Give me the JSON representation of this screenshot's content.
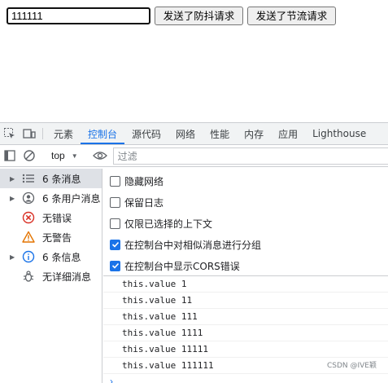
{
  "page": {
    "input_value": "111111",
    "debounce_button": "发送了防抖请求",
    "throttle_button": "发送了节流请求"
  },
  "devtools": {
    "tabs": [
      {
        "label": "元素",
        "active": false
      },
      {
        "label": "控制台",
        "active": true
      },
      {
        "label": "源代码",
        "active": false
      },
      {
        "label": "网络",
        "active": false
      },
      {
        "label": "性能",
        "active": false
      },
      {
        "label": "内存",
        "active": false
      },
      {
        "label": "应用",
        "active": false
      },
      {
        "label": "Lighthouse",
        "active": false
      }
    ],
    "toolbar": {
      "context": "top",
      "filter_placeholder": "过滤"
    },
    "sidebar": [
      {
        "label": "6 条消息",
        "icon": "list-icon",
        "expandable": true,
        "selected": true
      },
      {
        "label": "6 条用户消息",
        "icon": "user-icon",
        "expandable": true,
        "selected": false
      },
      {
        "label": "无错误",
        "icon": "error-icon",
        "expandable": false,
        "selected": false
      },
      {
        "label": "无警告",
        "icon": "warning-icon",
        "expandable": false,
        "selected": false
      },
      {
        "label": "6 条信息",
        "icon": "info-icon",
        "expandable": true,
        "selected": false
      },
      {
        "label": "无详细消息",
        "icon": "bug-icon",
        "expandable": false,
        "selected": false
      }
    ],
    "options": [
      {
        "label": "隐藏网络",
        "checked": false
      },
      {
        "label": "保留日志",
        "checked": false
      },
      {
        "label": "仅限已选择的上下文",
        "checked": false
      },
      {
        "label": "在控制台中对相似消息进行分组",
        "checked": true
      },
      {
        "label": "在控制台中显示CORS错误",
        "checked": true
      }
    ],
    "logs": [
      "this.value 1",
      "this.value 11",
      "this.value 111",
      "this.value 1111",
      "this.value 11111",
      "this.value 111111"
    ],
    "prompt_symbol": "›",
    "watermark": "CSDN @IVE颖"
  },
  "colors": {
    "accent": "#1a73e8",
    "error": "#d93025",
    "warning": "#e37400",
    "info": "#1a73e8"
  }
}
